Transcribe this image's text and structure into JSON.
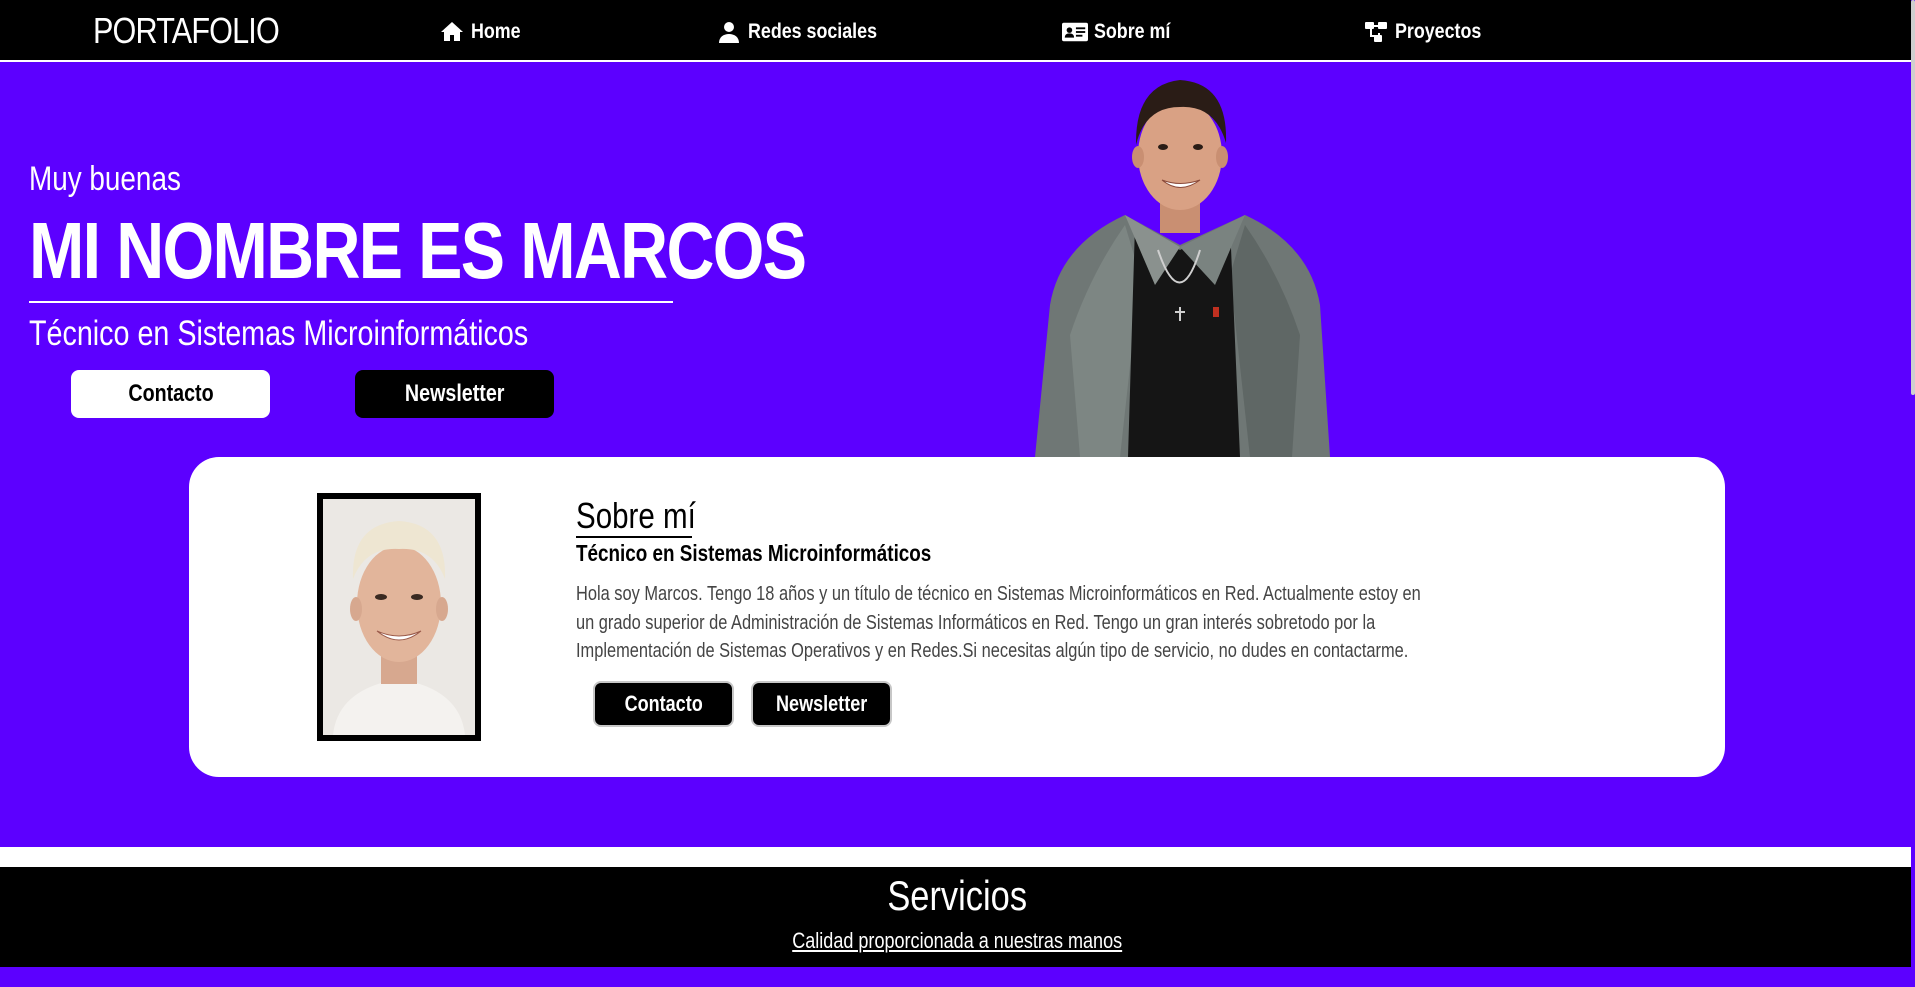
{
  "nav": {
    "brand": "PORTAFOLIO",
    "items": [
      {
        "label": "Home",
        "icon": "home-icon"
      },
      {
        "label": "Redes sociales",
        "icon": "user-icon"
      },
      {
        "label": "Sobre mí",
        "icon": "id-card-icon"
      },
      {
        "label": "Proyectos",
        "icon": "sitemap-icon"
      }
    ]
  },
  "hero": {
    "greeting": "Muy buenas",
    "name": "MI NOMBRE ES MARCOS",
    "subtitle": "Técnico en Sistemas Microinformáticos",
    "contact_label": "Contacto",
    "newsletter_label": "Newsletter"
  },
  "about": {
    "title": "Sobre mí",
    "subtitle": "Técnico en Sistemas Microinformáticos",
    "text": "Hola soy Marcos. Tengo 18 años y un título de técnico en Sistemas Microinformáticos en Red. Actualmente estoy en un grado superior de Administración de Sistemas Informáticos en Red. Tengo un gran interés sobretodo por la Implementación de Sistemas Operativos y en Redes.Si necesitas algún tipo de servicio, no dudes en contactarme.",
    "contact_label": "Contacto",
    "newsletter_label": "Newsletter"
  },
  "services": {
    "title": "Servicios",
    "subtitle": "Calidad proporcionada a nuestras manos"
  },
  "colors": {
    "accent": "#5c00ff",
    "dark": "#000000",
    "light": "#ffffff"
  }
}
